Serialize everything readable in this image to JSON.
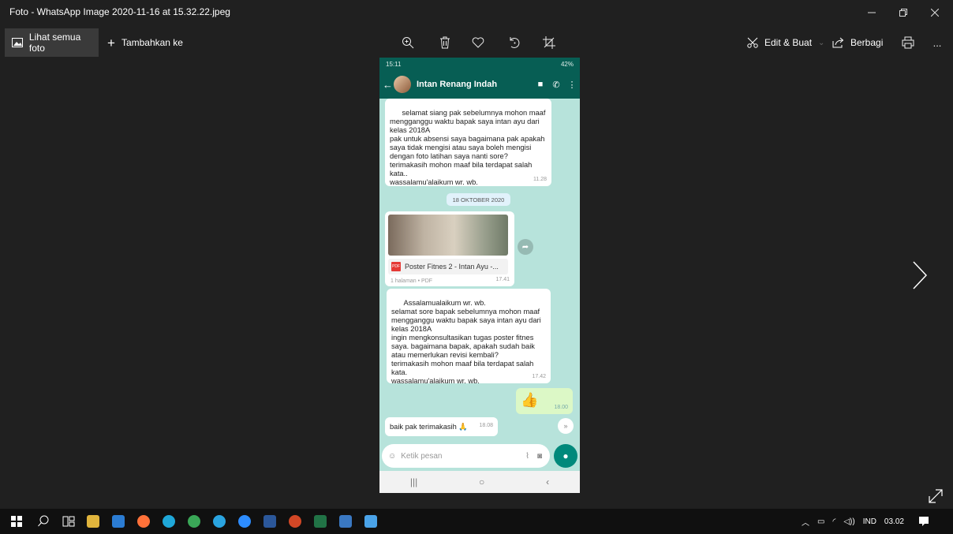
{
  "window": {
    "title": "Foto - WhatsApp Image 2020-11-16 at 15.32.22.jpeg"
  },
  "toolbar": {
    "see_all_label": "Lihat semua foto",
    "add_to_label": "Tambahkan ke",
    "edit_label": "Edit & Buat",
    "share_label": "Berbagi",
    "more_label": "..."
  },
  "phone": {
    "status_time": "15:11",
    "status_right": "42%",
    "contact_name": "Intan Renang Indah",
    "msg1_text": "selamat siang pak sebelumnya mohon maaf mengganggu waktu bapak saya intan ayu dari kelas 2018A\npak untuk absensi saya bagaimana pak apakah saya tidak mengisi atau saya boleh mengisi dengan foto latihan saya nanti sore?\nterimakasih mohon maaf bila terdapat salah kata..\nwassalamu'alaikum wr. wb.",
    "msg1_time": "11.28",
    "date_chip": "18 OKTOBER 2020",
    "doc_name": "Poster Fitnes 2 - Intan Ayu -...",
    "doc_meta": "1 halaman • PDF",
    "doc_time": "17.41",
    "msg2_text": "Assalamualaikum wr. wb.\nselamat sore bapak sebelumnya mohon maaf mengganggu waktu bapak saya intan ayu dari kelas 2018A\ningin mengkonsultasikan tugas poster fitnes saya. bagaimana bapak, apakah sudah baik atau memerlukan revisi kembali?\nterimakasih mohon maaf bila terdapat salah kata.\nwassalamu'alaikum wr. wb.",
    "msg2_time": "17.42",
    "out_emoji": "👍",
    "out_time": "18.00",
    "msg3_text": "baik pak terimakasih 🙏",
    "msg3_time": "18.08",
    "input_placeholder": "Ketik pesan"
  },
  "taskbar": {
    "language": "IND",
    "clock": "03.02"
  },
  "colors": {
    "app_bg": "#202020",
    "wa_header": "#075e54",
    "wa_chat_bg": "#b7e3db",
    "wa_out_bubble": "#dcf8c6",
    "wa_mic": "#00897b"
  }
}
